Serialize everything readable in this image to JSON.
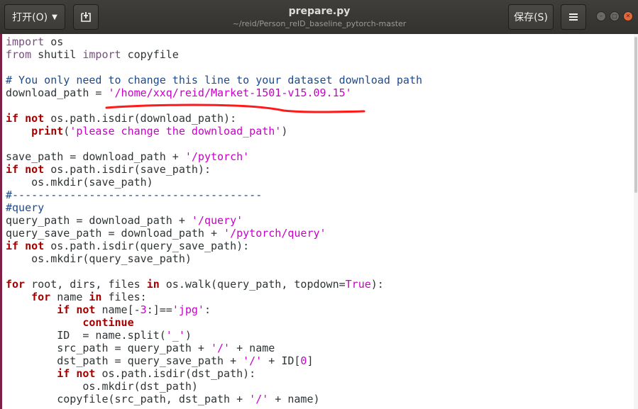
{
  "window": {
    "title": "prepare.py",
    "subtitle": "~/reid/Person_reID_baseline_pytorch-master"
  },
  "toolbar": {
    "open_label": "打开(O)",
    "save_label": "保存(S)",
    "newtab_icon": "new-document-icon",
    "menu_icon": "hamburger-menu-icon"
  },
  "code": [
    "import os",
    "from shutil import copyfile",
    "",
    "# You only need to change this line to your dataset download path",
    "download_path = '/home/xxq/reid/Market-1501-v15.09.15'",
    "",
    "if not os.path.isdir(download_path):",
    "    print('please change the download_path')",
    "",
    "save_path = download_path + '/pytorch'",
    "if not os.path.isdir(save_path):",
    "    os.mkdir(save_path)",
    "#---------------------------------------",
    "#query",
    "query_path = download_path + '/query'",
    "query_save_path = download_path + '/pytorch/query'",
    "if not os.path.isdir(query_save_path):",
    "    os.mkdir(query_save_path)",
    "",
    "for root, dirs, files in os.walk(query_path, topdown=True):",
    "    for name in files:",
    "        if not name[-3:]=='jpg':",
    "            continue",
    "        ID  = name.split('_')",
    "        src_path = query_path + '/' + name",
    "        dst_path = query_save_path + '/' + ID[0]",
    "        if not os.path.isdir(dst_path):",
    "            os.mkdir(dst_path)",
    "        copyfile(src_path, dst_path + '/' + name)"
  ],
  "colors": {
    "titlebar": "#3c3b37",
    "keyword": "#a40000",
    "string": "#c800c8",
    "comment": "#204a87",
    "annotation": "#ff0000"
  }
}
